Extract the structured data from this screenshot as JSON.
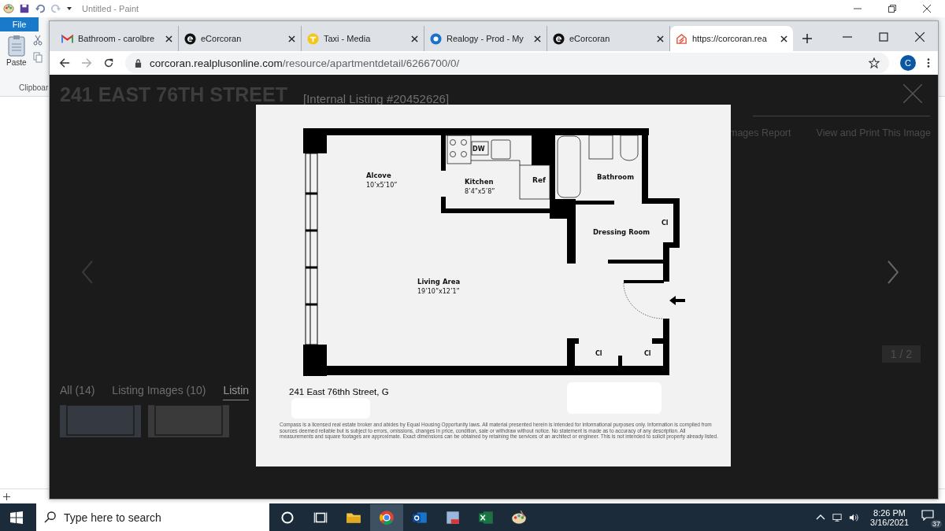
{
  "paint_window": {
    "title": "Untitled - Paint",
    "file_tab": "File",
    "paste_label": "Paste",
    "group_label": "Clipboar"
  },
  "browser": {
    "tabs": [
      {
        "title": "Bathroom - carolbre",
        "kind": "mail",
        "selected": false
      },
      {
        "title": "eCorcoran",
        "kind": "circle-e",
        "selected": false
      },
      {
        "title": "Taxi - Media",
        "kind": "taxi",
        "selected": false
      },
      {
        "title": "Realogy - Prod - My",
        "kind": "ring",
        "selected": false
      },
      {
        "title": "eCorcoran",
        "kind": "circle-e",
        "selected": false
      },
      {
        "title": "https://corcoran.rea",
        "kind": "house",
        "selected": true
      }
    ],
    "url_host": "corcoran.realplusonline.com",
    "url_path": "/resource/apartmentdetail/6266700/0/",
    "profile_initial": "C"
  },
  "listing": {
    "title": "241 EAST 76TH STREET",
    "internal_listing": "[Internal Listing #20452626]",
    "report_link": "mages Report",
    "print_link": "View and Print This Image",
    "counter": "1 / 2",
    "gallery_tabs": [
      {
        "label": "All (14)",
        "selected": false
      },
      {
        "label": "Listing Images (10)",
        "selected": false
      },
      {
        "label": "Listin",
        "selected": true
      }
    ]
  },
  "floor_plan": {
    "rooms": [
      {
        "name": "Alcove",
        "size": "10’x5’10”"
      },
      {
        "name": "Kitchen",
        "size": "8’4”x5’8”"
      },
      {
        "name": "Bathroom"
      },
      {
        "name": "Dressing Room"
      },
      {
        "name": "Living Area",
        "size": "19’10”x12’1”"
      }
    ],
    "fixture_labels": [
      "DW",
      "Ref",
      "Cl",
      "Cl",
      "Cl"
    ],
    "address": "241 East 76thh Street, G",
    "disclaimer": "Compass is a licensed real estate broker and abides by Equal Housing Opportunity laws. All material presented herein is intended for informational purposes only. Information is compiled from sources deemed reliable but is subject to errors, omissions, changes in price, condition, sale or withdraw without notice. No statement is made as to accuracy of any description. All measurements and square footages are approximate. Exact dimensions can be obtained by retaining the services of an architect or engineer. This is not intended to solicit property already listed."
  },
  "taskbar": {
    "search_placeholder": "Type here to search",
    "time": "8:26 PM",
    "date": "3/16/2021",
    "notification_count": "37"
  }
}
